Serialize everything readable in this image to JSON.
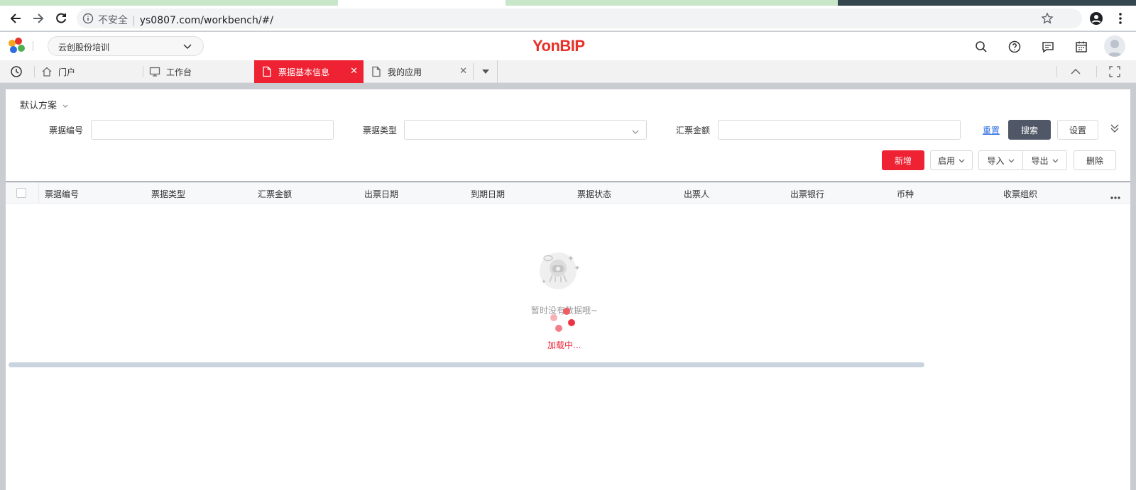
{
  "browser": {
    "url": "ys0807.com/workbench/#/",
    "security_label": "不安全",
    "tab_colors": [
      "#c8e6c9",
      "#ffffff",
      "#c8e6c9",
      "#37474f"
    ]
  },
  "header": {
    "tenant": "云创股份培训",
    "brand": "YonBIP",
    "icons": [
      "search-icon",
      "help-icon",
      "message-icon",
      "calendar-icon",
      "avatar"
    ]
  },
  "tabs": [
    {
      "label": "门户",
      "icon": "home-icon"
    },
    {
      "label": "工作台",
      "icon": "monitor-icon"
    },
    {
      "label": "票据基本信息",
      "icon": "document-icon",
      "active": true
    },
    {
      "label": "我的应用",
      "icon": "document-icon"
    }
  ],
  "filter": {
    "scheme": "默认方案",
    "fields": [
      {
        "label": "票据编号",
        "value": ""
      },
      {
        "label": "票据类型",
        "value": ""
      },
      {
        "label": "汇票金额",
        "value": ""
      }
    ],
    "reset": "重置",
    "search": "搜索",
    "settings": "设置"
  },
  "toolbar": {
    "add": "新增",
    "enable": "启用",
    "import": "导入",
    "export": "导出",
    "delete": "删除"
  },
  "table": {
    "columns": [
      "票据编号",
      "票据类型",
      "汇票金额",
      "出票日期",
      "到期日期",
      "票据状态",
      "出票人",
      "出票银行",
      "币种",
      "收票组织"
    ]
  },
  "empty_text": "暂时没有数据哦~",
  "loading_text": "加载中...",
  "colors": {
    "accent": "#ee2233",
    "search_button": "#505766",
    "link": "#2b6ce0"
  }
}
